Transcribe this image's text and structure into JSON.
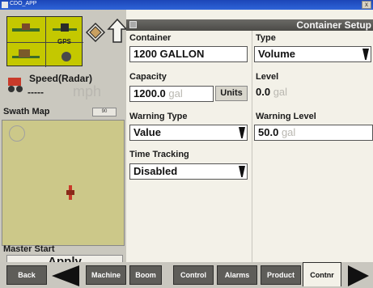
{
  "window": {
    "title": "CDO_APP",
    "close_label": "x"
  },
  "left_panel": {
    "gps_label": "GPS",
    "speed_title": "Speed(Radar)",
    "speed_value": "-----",
    "speed_unit": "mph",
    "swath_label": "Swath Map",
    "swath_button": "90",
    "master_label": "Master Start",
    "apply_label": "Apply"
  },
  "header": {
    "title": "Container Setup"
  },
  "form": {
    "container_label": "Container",
    "container_value": "1200 GALLON",
    "type_label": "Type",
    "type_value": "Volume",
    "capacity_label": "Capacity",
    "capacity_value": "1200.0",
    "capacity_unit": "gal",
    "units_button": "Units",
    "level_label": "Level",
    "level_value": "0.0",
    "level_unit": "gal",
    "warning_type_label": "Warning Type",
    "warning_type_value": "Value",
    "warning_level_label": "Warning Level",
    "warning_level_value": "50.0",
    "warning_level_unit": "gal",
    "time_tracking_label": "Time Tracking",
    "time_tracking_value": "Disabled"
  },
  "tabs": {
    "back": "Back",
    "items": [
      "Machine",
      "Boom",
      "Control",
      "Alarms",
      "Product",
      "Contnr"
    ],
    "active": "Contnr"
  },
  "colors": {
    "header_bg": "#55544f",
    "tab_bg": "#5e5d59",
    "map_bg": "#ccc889",
    "gps_tile": "#c4c800"
  }
}
